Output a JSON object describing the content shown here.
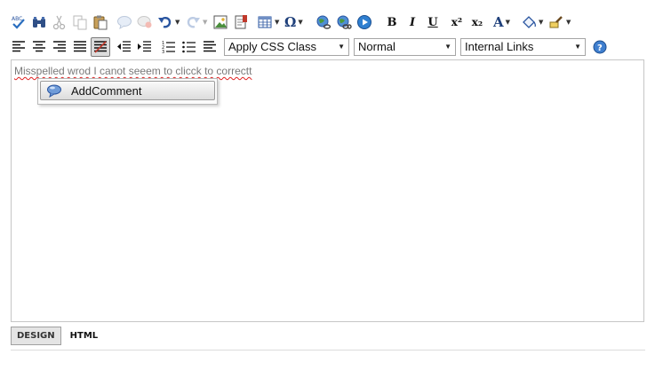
{
  "toolbar": {
    "icons": {
      "spellcheck": "spellcheck-icon",
      "find": "binoculars-icon",
      "cut": "scissors-icon",
      "copy": "copy-icon",
      "paste": "paste-icon",
      "comment": "comment-bubble-icon",
      "delete_comment": "delete-comment-icon",
      "undo": "undo-icon",
      "redo": "redo-icon",
      "image": "image-icon",
      "document": "document-icon",
      "table": "table-icon",
      "special_char": "omega-icon",
      "hyperlink": "globe-link-icon",
      "remove_link": "globe-unlink-icon",
      "media": "play-icon",
      "bold": "bold-icon",
      "italic": "italic-icon",
      "underline": "underline-icon",
      "superscript": "superscript-icon",
      "subscript": "subscript-icon",
      "font_color": "font-color-icon",
      "fill_color": "paint-bucket-icon",
      "format_brush": "format-brush-icon",
      "align_left": "align-left-icon",
      "align_center": "align-center-icon",
      "align_right": "align-right-icon",
      "justify": "justify-icon",
      "remove_alignment": "remove-alignment-icon",
      "outdent": "outdent-icon",
      "indent": "indent-icon",
      "numbered_list": "numbered-list-icon",
      "bulleted_list": "bulleted-list-icon",
      "paragraph": "paragraph-icon",
      "help": "help-icon"
    },
    "labels": {
      "bold": "B",
      "italic": "I",
      "underline": "U",
      "superscript": "x²",
      "subscript": "x₂",
      "font_color": "A",
      "special_char": "Ω"
    },
    "css_class": {
      "selected": "Apply CSS Class"
    },
    "paragraph_format": {
      "selected": "Normal"
    },
    "links": {
      "selected": "Internal Links"
    }
  },
  "editor": {
    "text": "Misspelled wrod I canot seeem to clicck to correctt"
  },
  "context_menu": {
    "items": [
      {
        "label": "AddComment"
      }
    ]
  },
  "mode_tabs": [
    {
      "label": "DESIGN",
      "active": true
    },
    {
      "label": "HTML",
      "active": false
    }
  ],
  "colors": {
    "accent_blue": "#2a6ebf",
    "misspelling": "#e02020",
    "border": "#c6c6c6"
  }
}
